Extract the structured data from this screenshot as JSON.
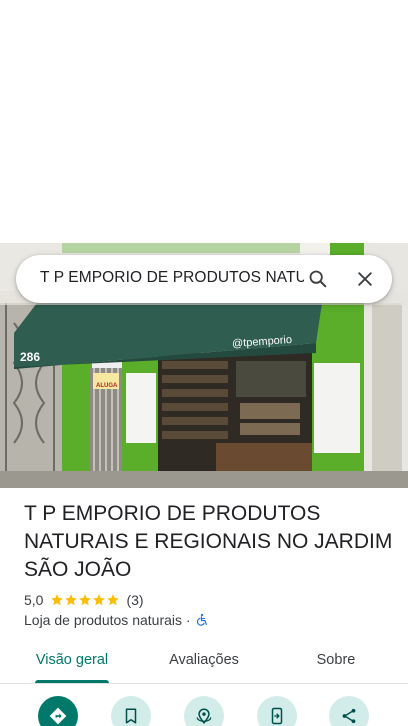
{
  "search": {
    "query": "T P EMPORIO DE PRODUTOS NATURAIS E REGIONAIS NO JARDIM SÃO JOÃO",
    "search_icon": "search-icon",
    "close_icon": "close-icon"
  },
  "photo": {
    "house_number": "286",
    "store_sign": "@tpemporio",
    "door_sign": "ALUGA"
  },
  "place": {
    "title": "T P EMPORIO DE PRODUTOS NATURAIS E REGIONAIS NO JARDIM SÃO JOÃO",
    "rating": "5,0",
    "stars": 5,
    "review_count": "(3)",
    "category": "Loja de produtos naturais",
    "separator": "·",
    "accessibility_icon": "wheelchair-icon"
  },
  "tabs": [
    {
      "label": "Visão geral",
      "active": true
    },
    {
      "label": "Avaliações",
      "active": false
    },
    {
      "label": "Sobre",
      "active": false
    }
  ],
  "actions": [
    {
      "icon": "directions-icon"
    },
    {
      "icon": "bookmark-icon"
    },
    {
      "icon": "nearby-icon"
    },
    {
      "icon": "send-to-phone-icon"
    },
    {
      "icon": "share-icon"
    }
  ],
  "colors": {
    "accent": "#00796b",
    "action_bg": "#d2ece9",
    "star": "#fbbc04",
    "awning": "#2f5e50",
    "storefront_green": "#5aae2a"
  }
}
